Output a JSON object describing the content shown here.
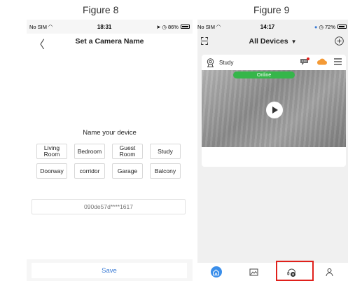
{
  "captions": {
    "left": "Figure 8",
    "right": "Figure 9"
  },
  "left_screen": {
    "status": {
      "carrier": "No SIM",
      "time": "18:31",
      "battery": "86%",
      "battery_level": 0.86
    },
    "nav": {
      "title": "Set a Camera Name",
      "back_glyph": "〈"
    },
    "prompt": "Name your device",
    "room_options": [
      "Living Room",
      "Bedroom",
      "Guest Room",
      "Study",
      "Doorway",
      "corridor",
      "Garage",
      "Balcony"
    ],
    "name_field": {
      "value": "",
      "placeholder": "090de57d****1617"
    },
    "save_label": "Save"
  },
  "right_screen": {
    "status": {
      "carrier": "No SIM",
      "time": "14:17",
      "battery": "72%",
      "battery_level": 0.72
    },
    "header": {
      "title": "All Devices",
      "caret": "▼"
    },
    "device": {
      "name": "Study",
      "status": "Online"
    },
    "tabs": [
      "home-icon",
      "gallery-icon",
      "service-icon",
      "profile-icon"
    ],
    "highlighted_tab": "service-icon"
  },
  "colors": {
    "accent": "#3a7bd5",
    "online": "#35b64a",
    "highlight": "#e0201b",
    "cloud": "#f49a36",
    "home_tab": "#3a8eea"
  },
  "icons": [
    "back-icon",
    "wifi-icon",
    "location-icon",
    "alarm-icon",
    "battery-icon",
    "scan-icon",
    "add-icon",
    "camera-icon",
    "message-icon",
    "cloud-icon",
    "menu-icon",
    "play-icon"
  ]
}
